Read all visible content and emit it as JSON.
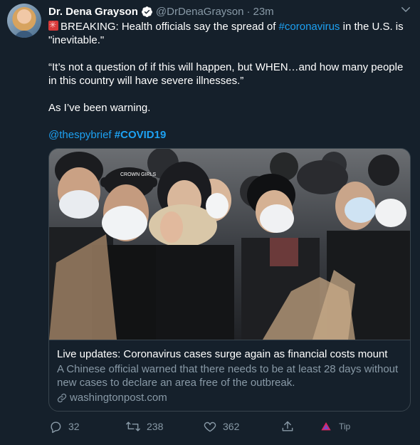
{
  "author": {
    "name": "Dr. Dena Grayson",
    "handle": "@DrDenaGrayson",
    "separator": "·",
    "time": "23m"
  },
  "tweet": {
    "line1_prefix": "BREAKING: Health officials say the spread of ",
    "line1_hashtag": "#coronavirus",
    "line1_suffix": " in the U.S. is \"inevitable.\"",
    "quote": "“It’s not a question of if this will happen, but WHEN…and how many people in this country will have severe illnesses.”",
    "warning": "As I’ve been warning.",
    "mention": "@thespybrief",
    "hashtag": "#COVID19"
  },
  "card": {
    "title": "Live updates: Coronavirus cases surge again as financial costs mount",
    "description": "A Chinese official warned that there needs to be at least 28 days without new cases to declare an area free of the outbreak.",
    "domain": "washingtonpost.com",
    "cap_text": "CROWN GIRLS"
  },
  "actions": {
    "replies": "32",
    "retweets": "238",
    "likes": "362",
    "tip": "Tip"
  },
  "colors": {
    "background": "#15202b",
    "accent": "#1da1f2",
    "muted": "#8899a6",
    "border": "#38444d"
  }
}
